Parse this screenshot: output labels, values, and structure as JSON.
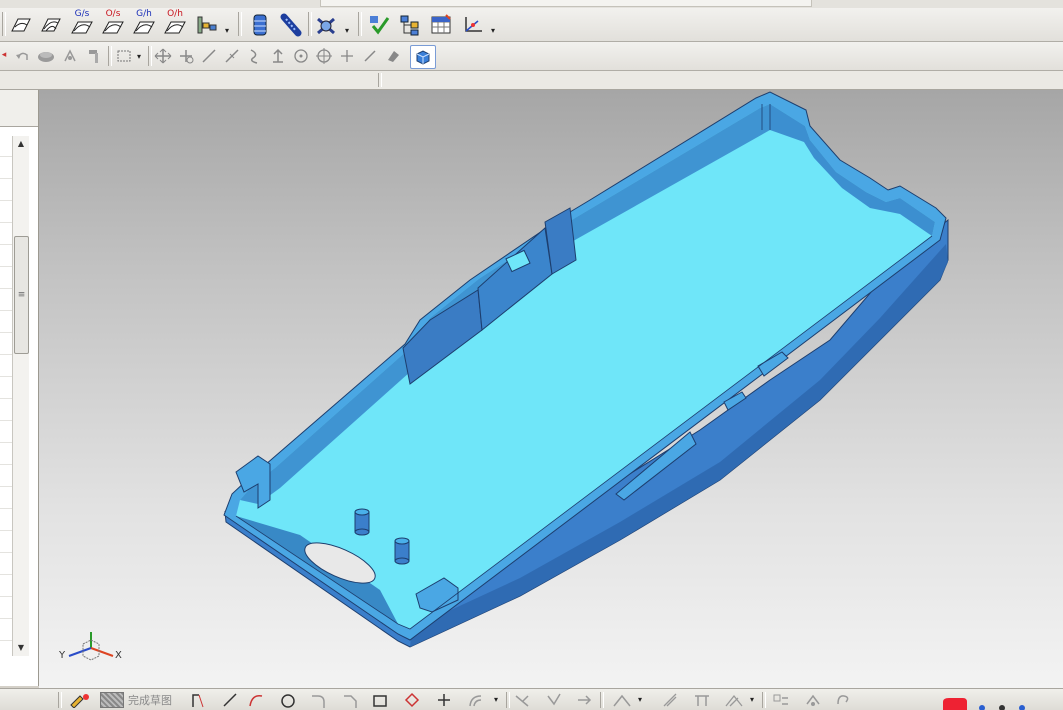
{
  "toolbar_top": {
    "analysis_buttons": [
      {
        "name": "deviation-check",
        "label": ""
      },
      {
        "name": "section-analysis",
        "label": ""
      },
      {
        "name": "g0-continuity",
        "label": "G/s"
      },
      {
        "name": "g1-continuity",
        "label": "O/s"
      },
      {
        "name": "g2-continuity",
        "label": "G/h"
      },
      {
        "name": "curvature-continuity",
        "label": "O/h"
      }
    ],
    "colors": {
      "label_blue": "#1a2fb8",
      "label_red": "#c8141e"
    }
  },
  "sketch_bar": {
    "finish_sketch_label": "完成草图"
  },
  "viewport": {
    "triad": {
      "x_label": "X",
      "y_label": "Y"
    },
    "model_colors": {
      "floor": "#6fe6f9",
      "wall_top": "#49b9e8",
      "wall_outer": "#3a7ec8",
      "wall_dark": "#2d64a8",
      "edge": "#1d3e6e"
    }
  }
}
